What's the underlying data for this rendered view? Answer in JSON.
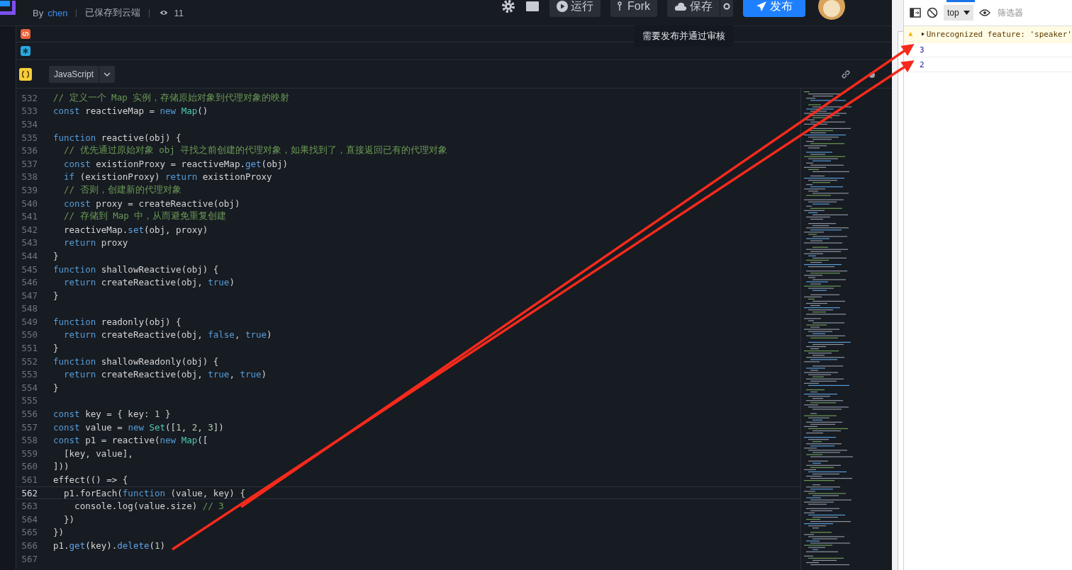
{
  "header": {
    "author_prefix": "By",
    "author": "chen",
    "save_status": "已保存到云端",
    "views": "11",
    "buttons": [
      {
        "kind": "run",
        "label": "运行"
      },
      {
        "kind": "fork",
        "label": "Fork"
      },
      {
        "kind": "save",
        "label": "保存"
      },
      {
        "kind": "publish",
        "label": "发布"
      }
    ],
    "tooltip": "需要发布并通过审核"
  },
  "panels": [
    {
      "kind": "html"
    },
    {
      "kind": "css"
    }
  ],
  "language": "JavaScript",
  "code": {
    "lines": [
      {
        "number": "532",
        "tokens": [
          {
            "kind": "comment",
            "text": "// 定义一个 Map 实例，存储原始对象到代理对象的映射"
          }
        ]
      },
      {
        "number": "533",
        "tokens": [
          {
            "kind": "keyword",
            "text": "const"
          },
          {
            "kind": "plain",
            "text": " reactiveMap = "
          },
          {
            "kind": "keyword",
            "text": "new"
          },
          {
            "kind": "type",
            "text": " Map"
          },
          {
            "kind": "plain",
            "text": "()"
          }
        ]
      },
      {
        "number": "534"
      },
      {
        "number": "535",
        "tokens": [
          {
            "kind": "keyword",
            "text": "function"
          },
          {
            "kind": "plain",
            "text": " reactive(obj) {"
          }
        ]
      },
      {
        "number": "536",
        "tokens": [
          {
            "kind": "comment",
            "text": "  // 优先通过原始对象 obj 寻找之前创建的代理对象，如果找到了，直接返回已有的代理对象"
          }
        ]
      },
      {
        "number": "537",
        "tokens": [
          {
            "kind": "keyword",
            "text": "  const"
          },
          {
            "kind": "plain",
            "text": " existionProxy = reactiveMap."
          },
          {
            "kind": "method",
            "text": "get"
          },
          {
            "kind": "plain",
            "text": "(obj)"
          }
        ]
      },
      {
        "number": "538",
        "tokens": [
          {
            "kind": "keyword",
            "text": "  if"
          },
          {
            "kind": "plain",
            "text": " (existionProxy) "
          },
          {
            "kind": "keyword",
            "text": "return"
          },
          {
            "kind": "plain",
            "text": " existionProxy"
          }
        ]
      },
      {
        "number": "539",
        "tokens": [
          {
            "kind": "comment",
            "text": "  // 否则，创建新的代理对象"
          }
        ]
      },
      {
        "number": "540",
        "tokens": [
          {
            "kind": "keyword",
            "text": "  const"
          },
          {
            "kind": "plain",
            "text": " proxy = createReactive(obj)"
          }
        ]
      },
      {
        "number": "541",
        "tokens": [
          {
            "kind": "comment",
            "text": "  // 存储到 Map 中，从而避免重复创建"
          }
        ]
      },
      {
        "number": "542",
        "tokens": [
          {
            "kind": "plain",
            "text": "  reactiveMap."
          },
          {
            "kind": "method",
            "text": "set"
          },
          {
            "kind": "plain",
            "text": "(obj, proxy)"
          }
        ]
      },
      {
        "number": "543",
        "tokens": [
          {
            "kind": "keyword",
            "text": "  return"
          },
          {
            "kind": "plain",
            "text": " proxy"
          }
        ]
      },
      {
        "number": "544",
        "tokens": [
          {
            "kind": "plain",
            "text": "}"
          }
        ]
      },
      {
        "number": "545",
        "tokens": [
          {
            "kind": "keyword",
            "text": "function"
          },
          {
            "kind": "plain",
            "text": " shallowReactive(obj) {"
          }
        ]
      },
      {
        "number": "546",
        "tokens": [
          {
            "kind": "keyword",
            "text": "  return"
          },
          {
            "kind": "plain",
            "text": " createReactive(obj, "
          },
          {
            "kind": "keyword",
            "text": "true"
          },
          {
            "kind": "plain",
            "text": ")"
          }
        ]
      },
      {
        "number": "547",
        "tokens": [
          {
            "kind": "plain",
            "text": "}"
          }
        ]
      },
      {
        "number": "548"
      },
      {
        "number": "549",
        "tokens": [
          {
            "kind": "keyword",
            "text": "function"
          },
          {
            "kind": "plain",
            "text": " readonly(obj) {"
          }
        ]
      },
      {
        "number": "550",
        "tokens": [
          {
            "kind": "keyword",
            "text": "  return"
          },
          {
            "kind": "plain",
            "text": " createReactive(obj, "
          },
          {
            "kind": "keyword",
            "text": "false"
          },
          {
            "kind": "plain",
            "text": ", "
          },
          {
            "kind": "keyword",
            "text": "true"
          },
          {
            "kind": "plain",
            "text": ")"
          }
        ]
      },
      {
        "number": "551",
        "tokens": [
          {
            "kind": "plain",
            "text": "}"
          }
        ]
      },
      {
        "number": "552",
        "tokens": [
          {
            "kind": "keyword",
            "text": "function"
          },
          {
            "kind": "plain",
            "text": " shallowReadonly(obj) {"
          }
        ]
      },
      {
        "number": "553",
        "tokens": [
          {
            "kind": "keyword",
            "text": "  return"
          },
          {
            "kind": "plain",
            "text": " createReactive(obj, "
          },
          {
            "kind": "keyword",
            "text": "true"
          },
          {
            "kind": "plain",
            "text": ", "
          },
          {
            "kind": "keyword",
            "text": "true"
          },
          {
            "kind": "plain",
            "text": ")"
          }
        ]
      },
      {
        "number": "554",
        "tokens": [
          {
            "kind": "plain",
            "text": "}"
          }
        ]
      },
      {
        "number": "555"
      },
      {
        "number": "556",
        "tokens": [
          {
            "kind": "keyword",
            "text": "const"
          },
          {
            "kind": "plain",
            "text": " key = { key: "
          },
          {
            "kind": "number",
            "text": "1"
          },
          {
            "kind": "plain",
            "text": " }"
          }
        ]
      },
      {
        "number": "557",
        "tokens": [
          {
            "kind": "keyword",
            "text": "const"
          },
          {
            "kind": "plain",
            "text": " value = "
          },
          {
            "kind": "keyword",
            "text": "new"
          },
          {
            "kind": "type",
            "text": " Set"
          },
          {
            "kind": "plain",
            "text": "(["
          },
          {
            "kind": "number",
            "text": "1"
          },
          {
            "kind": "plain",
            "text": ", "
          },
          {
            "kind": "number",
            "text": "2"
          },
          {
            "kind": "plain",
            "text": ", "
          },
          {
            "kind": "number",
            "text": "3"
          },
          {
            "kind": "plain",
            "text": "])"
          }
        ]
      },
      {
        "number": "558",
        "tokens": [
          {
            "kind": "keyword",
            "text": "const"
          },
          {
            "kind": "plain",
            "text": " p1 = reactive("
          },
          {
            "kind": "keyword",
            "text": "new"
          },
          {
            "kind": "type",
            "text": " Map"
          },
          {
            "kind": "plain",
            "text": "(["
          }
        ]
      },
      {
        "number": "559",
        "tokens": [
          {
            "kind": "plain",
            "text": "  [key, value],"
          }
        ]
      },
      {
        "number": "560",
        "tokens": [
          {
            "kind": "plain",
            "text": "]))"
          }
        ]
      },
      {
        "number": "561",
        "tokens": [
          {
            "kind": "plain",
            "text": "effect(() => {"
          }
        ]
      },
      {
        "number": "562",
        "current": true,
        "tokens": [
          {
            "kind": "plain",
            "text": "  p1.forEach("
          },
          {
            "kind": "keyword",
            "text": "function"
          },
          {
            "kind": "plain",
            "text": " (value, key) {"
          }
        ]
      },
      {
        "number": "563",
        "tokens": [
          {
            "kind": "plain",
            "text": "    console.log(value.size) "
          },
          {
            "kind": "comment",
            "text": "// 3"
          }
        ]
      },
      {
        "number": "564",
        "tokens": [
          {
            "kind": "plain",
            "text": "  })"
          }
        ]
      },
      {
        "number": "565",
        "tokens": [
          {
            "kind": "plain",
            "text": "})"
          }
        ]
      },
      {
        "number": "566",
        "tokens": [
          {
            "kind": "plain",
            "text": "p1."
          },
          {
            "kind": "method",
            "text": "get"
          },
          {
            "kind": "plain",
            "text": "(key)."
          },
          {
            "kind": "method",
            "text": "delete"
          },
          {
            "kind": "plain",
            "text": "("
          },
          {
            "kind": "number",
            "text": "1"
          },
          {
            "kind": "plain",
            "text": ")"
          }
        ]
      },
      {
        "number": "567"
      }
    ]
  },
  "devtools": {
    "context": "top",
    "filter_placeholder": "筛选器",
    "messages": [
      {
        "kind": "warning",
        "text": "Unrecognized feature: 'speaker'"
      },
      {
        "kind": "log",
        "text": "3"
      },
      {
        "kind": "log",
        "text": "2"
      }
    ]
  }
}
